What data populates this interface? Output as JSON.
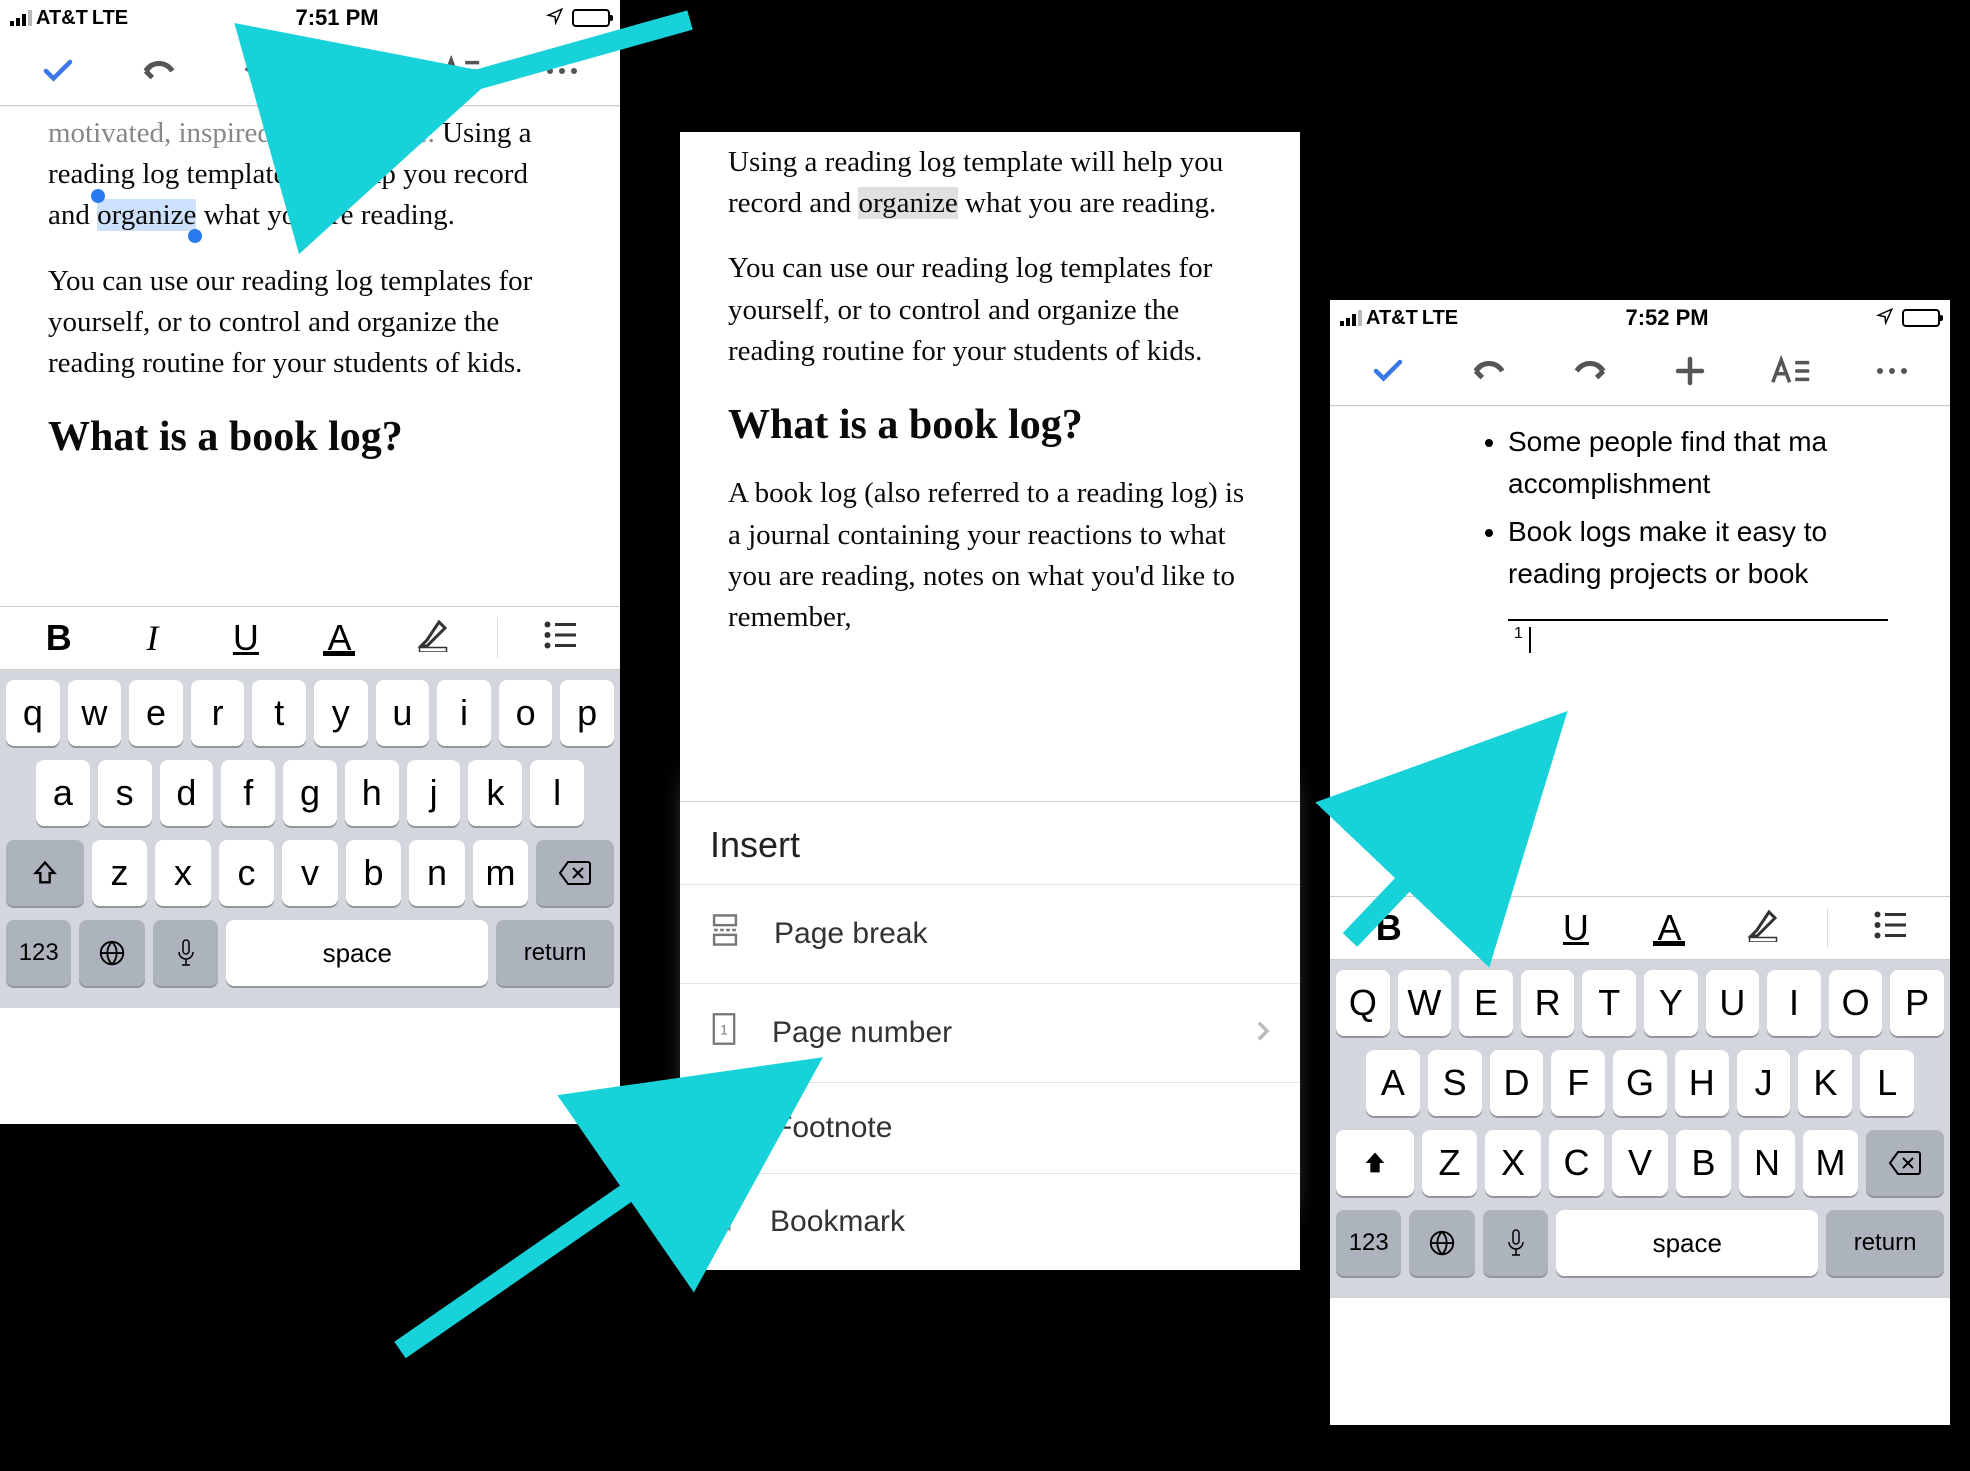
{
  "status": {
    "carrier": "AT&T",
    "network": "LTE",
    "time1": "7:51 PM",
    "time3": "7:52 PM"
  },
  "doc": {
    "line0": "motivated, inspired and organize.",
    "line1a": "Using a reading log template will help you record and ",
    "selword": "organize",
    "line1b": " what you are reading.",
    "para2": "You can use our reading log templates for yourself, or to control and organize the reading routine for your students of kids.",
    "heading": "What is a book log?",
    "para3": "A book log (also referred to a reading log) is a journal containing your reactions to what you are reading, notes on what you'd like to remember,"
  },
  "insert": {
    "title": "Insert",
    "page_break": "Page break",
    "page_number": "Page number",
    "footnote": "Footnote",
    "bookmark": "Bookmark"
  },
  "doc3": {
    "bullet1a": "Some people find that ma",
    "bullet1b": "accomplishment",
    "bullet2a": "Book logs make it easy to",
    "bullet2b": "reading projects or book ",
    "fn_num": "1"
  },
  "fmt": {
    "bold": "B",
    "italic": "I",
    "underline": "U",
    "textcolor": "A",
    "highlight": "",
    "list": ""
  },
  "keyboard": {
    "row1_upper": [
      "Q",
      "W",
      "E",
      "R",
      "T",
      "Y",
      "U",
      "I",
      "O",
      "P"
    ],
    "row1_lower": [
      "q",
      "w",
      "e",
      "r",
      "t",
      "y",
      "u",
      "i",
      "o",
      "p"
    ],
    "row2_upper": [
      "A",
      "S",
      "D",
      "F",
      "G",
      "H",
      "J",
      "K",
      "L"
    ],
    "row2_lower": [
      "a",
      "s",
      "d",
      "f",
      "g",
      "h",
      "j",
      "k",
      "l"
    ],
    "row3_upper": [
      "Z",
      "X",
      "C",
      "V",
      "B",
      "N",
      "M"
    ],
    "row3_lower": [
      "z",
      "x",
      "c",
      "v",
      "b",
      "n",
      "m"
    ],
    "num_key": "123",
    "space": "space",
    "return": "return"
  }
}
